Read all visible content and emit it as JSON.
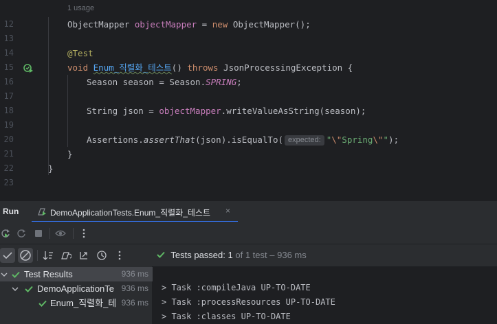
{
  "editor": {
    "usage_hint": "1 usage",
    "line_numbers": [
      "12",
      "13",
      "14",
      "15",
      "16",
      "17",
      "18",
      "19",
      "20",
      "21",
      "22",
      "23"
    ],
    "code": {
      "l12_type": "ObjectMapper",
      "l12_field": "objectMapper",
      "l12_eq": " = ",
      "l12_new": "new",
      "l12_rest": " ObjectMapper();",
      "l14_annotation": "@Test",
      "l15_void": "void",
      "l15_method": "Enum_직렬화_테스트",
      "l15_parens": "() ",
      "l15_throws": "throws",
      "l15_rest": " JsonProcessingException {",
      "l16_start": "Season season = Season.",
      "l16_const": "SPRING",
      "l16_end": ";",
      "l18_start": "String json = ",
      "l18_field": "objectMapper",
      "l18_rest": ".writeValueAsString(season);",
      "l20_class": "Assertions.",
      "l20_method": "assertThat",
      "l20_mid": "(json).isEqualTo(",
      "l20_hint": "expected:",
      "l20_q1": "\"",
      "l20_esc1": "\\\"",
      "l20_str": "Spring",
      "l20_esc2": "\\\"",
      "l20_q2": "\"",
      "l20_end": ");",
      "l21": "}",
      "l22": "}"
    }
  },
  "tool_window": {
    "title": "Run",
    "tab_label": "DemoApplicationTests.Enum_직렬화_테스트",
    "tab_close": "×"
  },
  "test_status": {
    "label": "Tests passed:",
    "passed": "1",
    "rest": "of 1 test",
    "dash": "–",
    "time": "936 ms"
  },
  "test_tree": [
    {
      "label": "Test Results",
      "time": "936 ms"
    },
    {
      "label": "DemoApplicationTe",
      "time": "936 ms"
    },
    {
      "label": "Enum_직렬화_테",
      "time": "936 ms"
    }
  ],
  "console": [
    "> Task :compileJava UP-TO-DATE",
    "> Task :processResources UP-TO-DATE",
    "> Task :classes UP-TO-DATE"
  ],
  "icons": {
    "run_gutter": "run-test-gutter-icon",
    "rerun": "rerun-icon",
    "rerun_failed": "rerun-failed-icon",
    "stop": "stop-icon",
    "show_passed": "show-passed-icon",
    "show_ignored": "show-ignored-icon",
    "sort": "sort-icon",
    "import_tests": "import-tests-icon",
    "collapse": "collapse-icon",
    "history": "history-icon",
    "more": "more-icon"
  },
  "colors": {
    "background": "#1e1f22",
    "panel": "#2b2d30",
    "success": "#5fb865",
    "accent": "#3574f0"
  }
}
